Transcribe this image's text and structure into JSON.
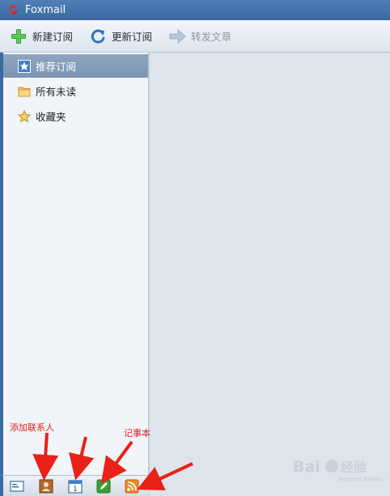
{
  "window": {
    "title": "Foxmail"
  },
  "toolbar": {
    "new_label": "新建订阅",
    "refresh_label": "更新订阅",
    "forward_label": "转发文章"
  },
  "sidebar": {
    "items": [
      {
        "label": "推荐订阅",
        "icon": "star-badge-icon"
      },
      {
        "label": "所有未读",
        "icon": "folder-icon"
      },
      {
        "label": "收藏夹",
        "icon": "star-icon"
      }
    ]
  },
  "annotations": {
    "add_contact": "添加联系人",
    "notepad": "记事本"
  },
  "bottombar": {
    "icons": [
      "mail-icon",
      "contacts-icon",
      "calendar-icon",
      "notepad-icon",
      "rss-icon"
    ],
    "calendar_day": "1"
  },
  "watermark": {
    "brand": "Bai",
    "brand2": "经验",
    "site": "jingyan.baidu.com"
  },
  "colors": {
    "accent": "#3b6aa3",
    "selected": "#7f99b6",
    "annotation": "#e0201a"
  }
}
